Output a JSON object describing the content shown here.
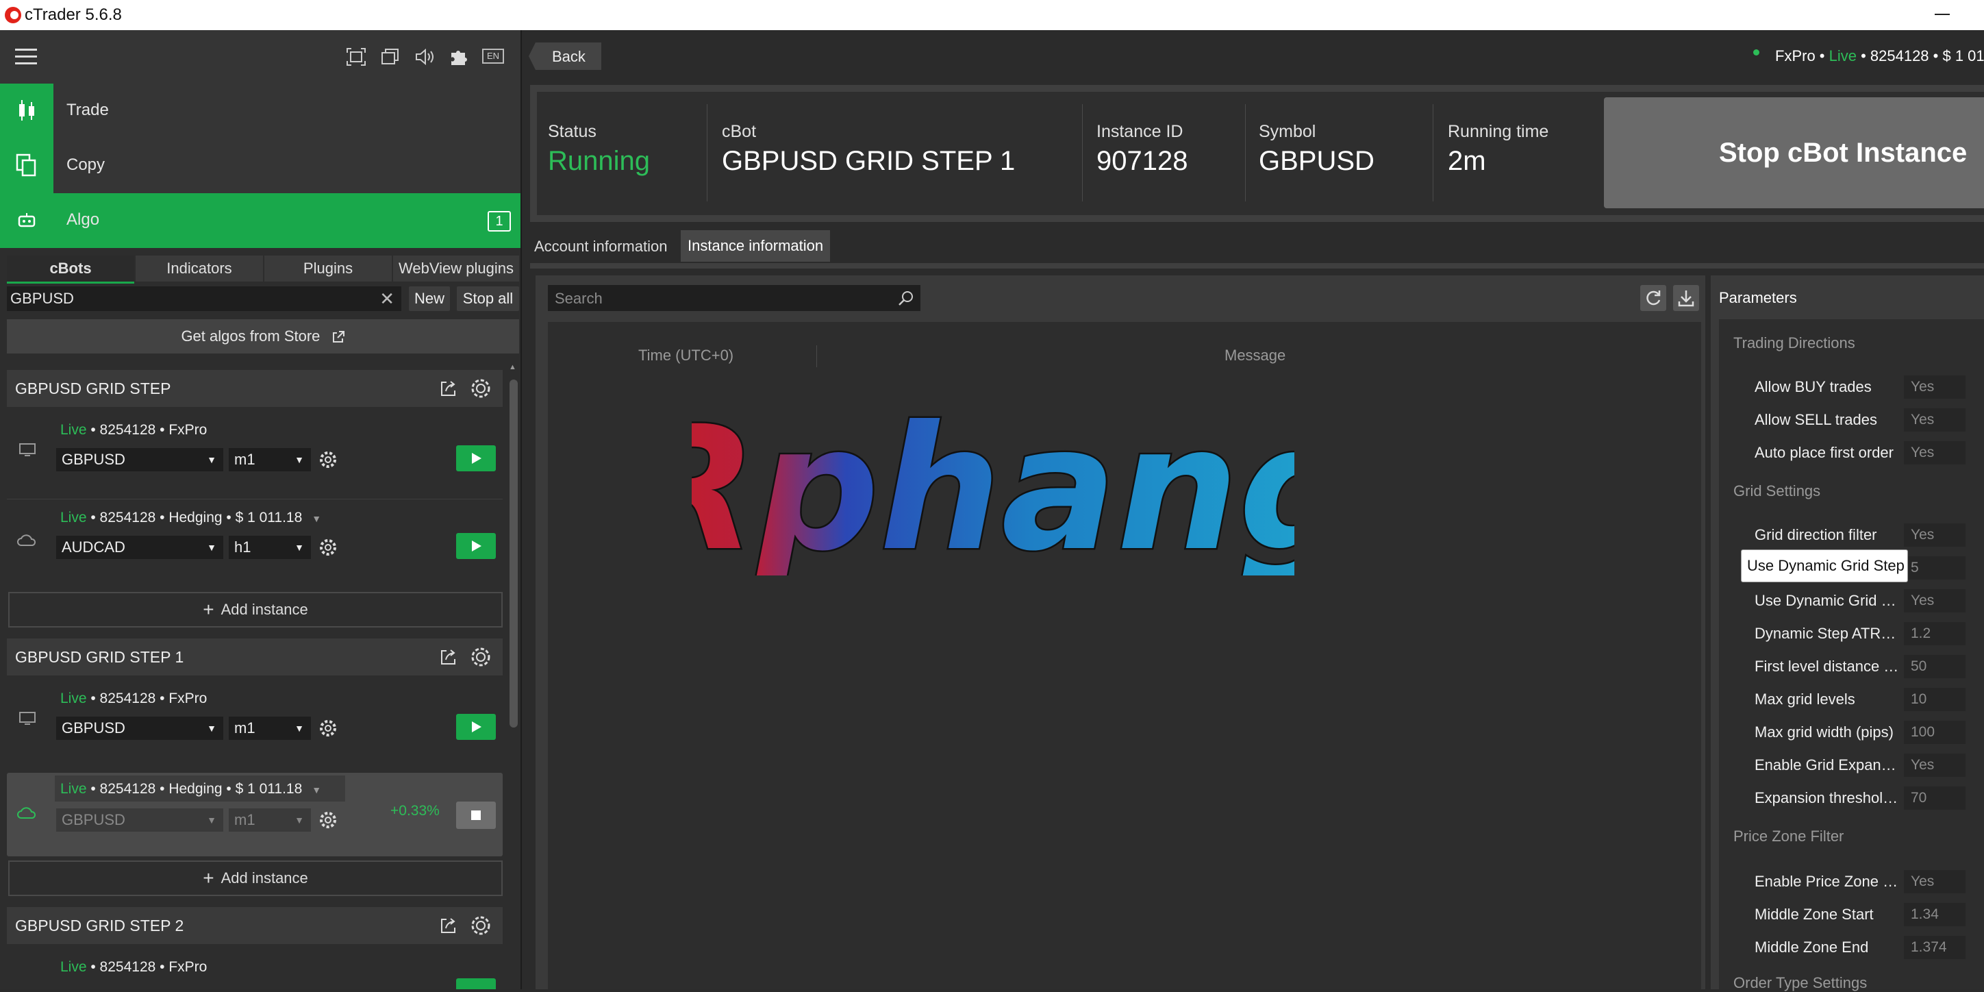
{
  "window": {
    "title": "cTrader 5.6.8"
  },
  "topbar": {
    "lang_badge": "EN"
  },
  "nav": [
    {
      "label": "Trade"
    },
    {
      "label": "Copy"
    },
    {
      "label": "Algo",
      "badge": "1"
    }
  ],
  "subtabs": [
    "cBots",
    "Indicators",
    "Plugins",
    "WebView plugins"
  ],
  "search": {
    "value": "GBPUSD"
  },
  "buttons": {
    "new": "New",
    "stop_all": "Stop all",
    "store": "Get algos from Store",
    "add_instance": "Add instance"
  },
  "groups": [
    {
      "title": "GBPUSD GRID STEP",
      "instances": [
        {
          "live": "Live",
          "meta": " • 8254128 •  FxPro",
          "symbol": "GBPUSD",
          "timeframe": "m1",
          "running": false
        },
        {
          "live": "Live",
          "meta": " • 8254128 • Hedging • $ 1 011.18",
          "symbol": "AUDCAD",
          "timeframe": "h1",
          "running": false
        }
      ]
    },
    {
      "title": "GBPUSD GRID STEP 1",
      "instances": [
        {
          "live": "Live",
          "meta": " • 8254128 •  FxPro",
          "symbol": "GBPUSD",
          "timeframe": "m1",
          "running": false
        },
        {
          "live": "Live",
          "meta": " • 8254128 • Hedging • $ 1 011.18",
          "symbol": "GBPUSD",
          "timeframe": "m1",
          "running": true,
          "pnl": "+0.33%"
        }
      ]
    },
    {
      "title": "GBPUSD GRID STEP 2",
      "instances": [
        {
          "live": "Live",
          "meta": " • 8254128 •  FxPro"
        }
      ]
    }
  ],
  "header": {
    "back": "Back",
    "account": {
      "broker": "FxPro • ",
      "live": "Live",
      "rest": " • 8254128 • $ 1 01"
    }
  },
  "status": {
    "status_label": "Status",
    "status_value": "Running",
    "cbot_label": "cBot",
    "cbot_value": "GBPUSD GRID STEP 1",
    "instance_label": "Instance ID",
    "instance_value": "907128",
    "symbol_label": "Symbol",
    "symbol_value": "GBPUSD",
    "running_label": "Running time",
    "running_value": "2m",
    "stop_button": "Stop cBot Instance"
  },
  "tabs": [
    "Account information",
    "Instance information"
  ],
  "log": {
    "search_placeholder": "Search",
    "col_time": "Time (UTC+0)",
    "col_message": "Message",
    "watermark": "Rphang"
  },
  "parameters": {
    "title": "Parameters",
    "tooltip": "Use Dynamic Grid Step",
    "sections": [
      {
        "title": "Trading Directions",
        "rows": [
          {
            "label": "Allow BUY trades",
            "value": "Yes"
          },
          {
            "label": "Allow SELL trades",
            "value": "Yes"
          },
          {
            "label": "Auto place first order",
            "value": "Yes"
          }
        ]
      },
      {
        "title": "Grid Settings",
        "rows": [
          {
            "label": "Grid direction filter",
            "value": "Yes"
          },
          {
            "label": "",
            "value": "5"
          },
          {
            "label": "Use Dynamic Grid …",
            "value": "Yes"
          },
          {
            "label": "Dynamic Step ATR…",
            "value": "1.2"
          },
          {
            "label": "First level distance …",
            "value": "50"
          },
          {
            "label": "Max grid levels",
            "value": "10"
          },
          {
            "label": "Max grid width (pips)",
            "value": "100"
          },
          {
            "label": "Enable Grid Expan…",
            "value": "Yes"
          },
          {
            "label": "Expansion threshol…",
            "value": "70"
          }
        ]
      },
      {
        "title": "Price Zone Filter",
        "rows": [
          {
            "label": "Enable Price Zone …",
            "value": "Yes"
          },
          {
            "label": "Middle Zone Start",
            "value": "1.34"
          },
          {
            "label": "Middle Zone End",
            "value": "1.374"
          }
        ]
      },
      {
        "title": "Order Type Settings",
        "rows": []
      }
    ]
  },
  "colors": {
    "accent": "#19a84b",
    "live": "#2dbd58",
    "running": "#2dbd58"
  }
}
